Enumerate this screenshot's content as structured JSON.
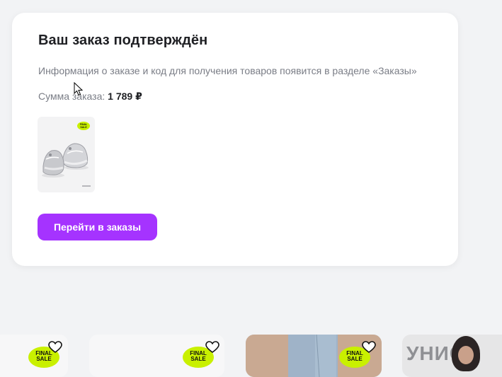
{
  "confirmation": {
    "title": "Ваш заказ подтверждён",
    "description": "Информация о заказе и код для получения товаров появится в разделе «Заказы»",
    "sum_label": "Сумма заказа: ",
    "sum_value": "1 789 ₽",
    "thumb_badge": "FINAL SALE",
    "button_label": "Перейти в заказы"
  },
  "product_row": {
    "tiles": [
      {
        "badge": "FINAL SALE"
      },
      {
        "badge": "FINAL SALE"
      },
      {
        "badge": "FINAL SALE"
      },
      {
        "image_text": "УНИСЕ"
      }
    ]
  },
  "colors": {
    "accent": "#a533ff",
    "badge": "#c9f000",
    "page_bg": "#f2f3f5"
  }
}
